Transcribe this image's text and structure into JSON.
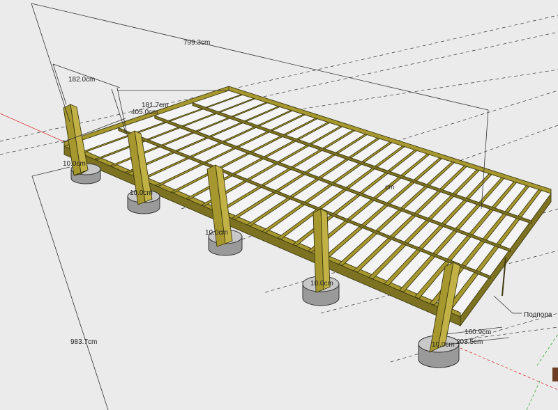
{
  "dimensions": {
    "overall_length": "799.3cm",
    "span_a": "182.0cm",
    "span_b": "181.7cm",
    "half_length": "405.0cm",
    "overall_width": "983.7cm",
    "end_short": "160.9cm",
    "end_long": "203.5cm",
    "post_size_label": "10.0cm",
    "mid_label": "cm"
  },
  "annotations": {
    "support": "Подпора"
  },
  "colors": {
    "wood": "#a6972f",
    "concrete": "#c8c8c8",
    "background": "#ebebeb"
  }
}
